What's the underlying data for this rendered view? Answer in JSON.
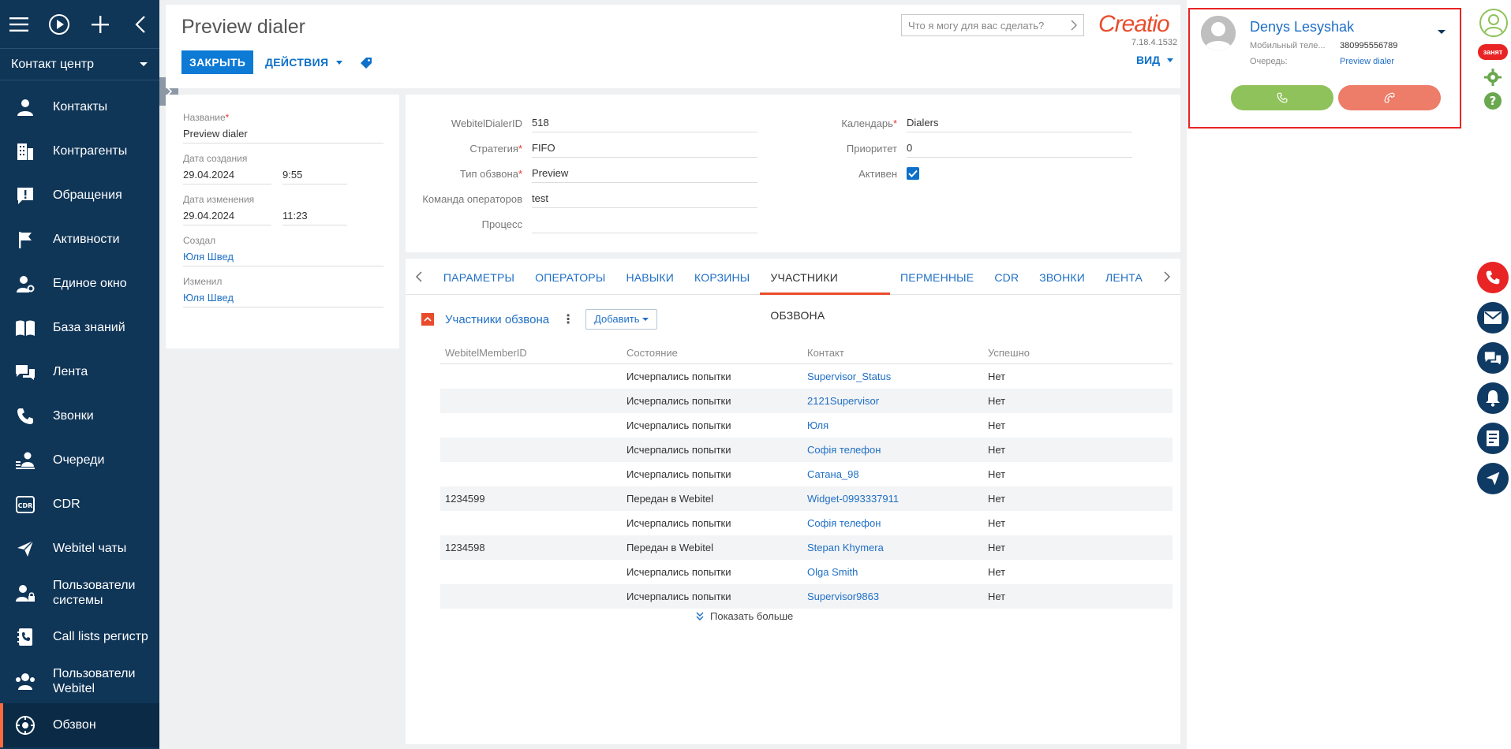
{
  "sidebar": {
    "section": "Контакт центр",
    "items": [
      {
        "label": "Контакты",
        "icon": "person-icon"
      },
      {
        "label": "Контрагенты",
        "icon": "building-icon"
      },
      {
        "label": "Обращения",
        "icon": "alert-icon"
      },
      {
        "label": "Активности",
        "icon": "flag-icon"
      },
      {
        "label": "Единое окно",
        "icon": "person-gear-icon"
      },
      {
        "label": "База знаний",
        "icon": "book-icon"
      },
      {
        "label": "Лента",
        "icon": "feed-icon"
      },
      {
        "label": "Звонки",
        "icon": "phone-icon"
      },
      {
        "label": "Очереди",
        "icon": "queue-icon"
      },
      {
        "label": "CDR",
        "icon": "cdr-icon"
      },
      {
        "label": "Webitel чаты",
        "icon": "send-icon"
      },
      {
        "label": "Пользователи системы",
        "icon": "user-lock-icon"
      },
      {
        "label": "Call lists регистр",
        "icon": "phone-book-icon"
      },
      {
        "label": "Пользователи Webitel",
        "icon": "users-icon"
      },
      {
        "label": "Обзвон",
        "icon": "dialer-icon"
      }
    ]
  },
  "header": {
    "title": "Preview dialer",
    "close_label": "ЗАКРЫТЬ",
    "actions_label": "ДЕЙСТВИЯ",
    "search_placeholder": "Что я могу для вас сделать?",
    "logo": "Creatio",
    "version": "7.18.4.1532",
    "view_label": "ВИД"
  },
  "info": {
    "name_label": "Название",
    "name_value": "Preview dialer",
    "created_label": "Дата создания",
    "created_date": "29.04.2024",
    "created_time": "9:55",
    "modified_label": "Дата изменения",
    "modified_date": "29.04.2024",
    "modified_time": "11:23",
    "created_by_label": "Создал",
    "created_by": "Юля Швед",
    "modified_by_label": "Изменил",
    "modified_by": "Юля Швед"
  },
  "form": {
    "dialer_id_label": "WebitelDialerID",
    "dialer_id": "518",
    "strategy_label": "Стратегия",
    "strategy": "FIFO",
    "type_label": "Тип обзвона",
    "type": "Preview",
    "team_label": "Команда операторов",
    "team": "test",
    "process_label": "Процесс",
    "process": "",
    "calendar_label": "Календарь",
    "calendar": "Dialers",
    "priority_label": "Приоритет",
    "priority": "0",
    "active_label": "Активен",
    "active": true
  },
  "tabs": [
    "ПАРАМЕТРЫ",
    "ОПЕРАТОРЫ",
    "НАВЫКИ",
    "КОРЗИНЫ",
    "УЧАСТНИКИ ОБЗВОНА",
    "ПЕРМЕННЫЕ",
    "CDR",
    "ЗВОНКИ",
    "ЛЕНТА"
  ],
  "active_tab": "УЧАСТНИКИ ОБЗВОНА",
  "detail": {
    "title": "Участники обзвона",
    "add_label": "Добавить",
    "columns": [
      "WebitelMemberID",
      "Состояние",
      "Контакт",
      "Успешно"
    ],
    "rows": [
      [
        "",
        "Исчерпались попытки",
        "Supervisor_Status",
        "Нет"
      ],
      [
        "",
        "Исчерпались попытки",
        "2121Supervisor",
        "Нет"
      ],
      [
        "",
        "Исчерпались попытки",
        "Юля",
        "Нет"
      ],
      [
        "",
        "Исчерпались попытки",
        "Софія телефон",
        "Нет"
      ],
      [
        "",
        "Исчерпались попытки",
        "Сатана_98",
        "Нет"
      ],
      [
        "1234599",
        "Передан в Webitel",
        "Widget-0993337911",
        "Нет"
      ],
      [
        "",
        "Исчерпались попытки",
        "Софія телефон",
        "Нет"
      ],
      [
        "1234598",
        "Передан в Webitel",
        "Stepan Khymera",
        "Нет"
      ],
      [
        "",
        "Исчерпались попытки",
        "Olga Smith",
        "Нет"
      ],
      [
        "",
        "Исчерпались попытки",
        "Supervisor9863",
        "Нет"
      ]
    ],
    "show_more": "Показать больше"
  },
  "cti": {
    "name": "Denys Lesyshak",
    "mobile_label": "Мобильный теле...",
    "mobile": "380995556789",
    "queue_label": "Очередь:",
    "queue": "Preview dialer",
    "status_badge": "занят"
  },
  "colors": {
    "sidebar": "#0f3557",
    "accent": "#e94c2c",
    "primary": "#0d7ad5",
    "accept": "#8fc25a",
    "reject": "#ed7c68",
    "highlight_border": "#e82424"
  }
}
